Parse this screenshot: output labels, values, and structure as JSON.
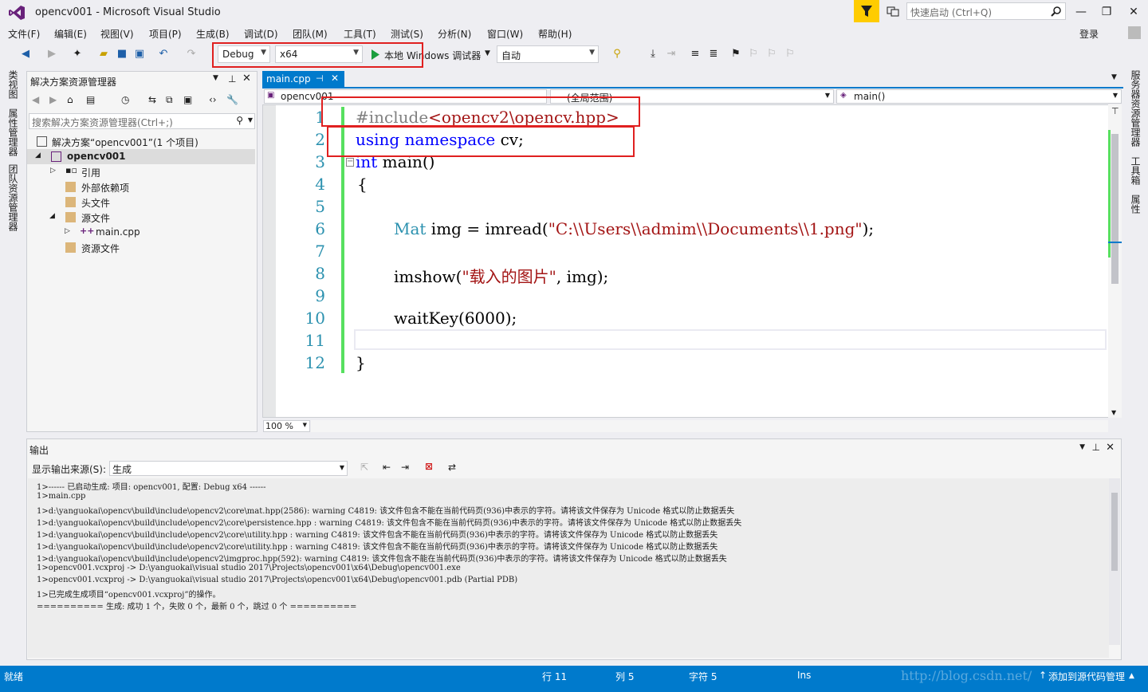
{
  "window": {
    "title": "opencv001 - Microsoft Visual Studio",
    "quick_launch_placeholder": "快速启动 (Ctrl+Q)",
    "login": "登录"
  },
  "menu": [
    "文件(F)",
    "编辑(E)",
    "视图(V)",
    "项目(P)",
    "生成(B)",
    "调试(D)",
    "团队(M)",
    "工具(T)",
    "测试(S)",
    "分析(N)",
    "窗口(W)",
    "帮助(H)"
  ],
  "toolbar": {
    "config": "Debug",
    "platform": "x64",
    "run_label": "本地 Windows 调试器",
    "run_mode": "自动"
  },
  "left_vtabs": [
    "类视图",
    "属性管理器",
    "团队资源管理器"
  ],
  "right_vtabs": [
    "服务器资源管理器",
    "工具箱",
    "属性"
  ],
  "solution_explorer": {
    "title": "解决方案资源管理器",
    "search_placeholder": "搜索解决方案资源管理器(Ctrl+;)",
    "items": [
      {
        "label": "解决方案“opencv001”(1 个项目)"
      },
      {
        "label": "opencv001"
      },
      {
        "label": "引用"
      },
      {
        "label": "外部依赖项"
      },
      {
        "label": "头文件"
      },
      {
        "label": "源文件"
      },
      {
        "label": "main.cpp"
      },
      {
        "label": "资源文件"
      }
    ]
  },
  "editor": {
    "tab_label": "main.cpp",
    "nav_project": "opencv001",
    "nav_scope": "(全局范围)",
    "nav_member": "main()",
    "zoom": "100 %",
    "line_numbers": [
      "1",
      "2",
      "3",
      "4",
      "5",
      "6",
      "7",
      "8",
      "9",
      "10",
      "11",
      "12"
    ],
    "code": {
      "l1_a": "#include",
      "l1_b": "<opencv2\\opencv.hpp>",
      "l2_a": "using",
      "l2_b": "namespace",
      "l2_c": " cv;",
      "l3_a": "int",
      "l3_b": " main()",
      "l4": "{",
      "l6_a": "Mat",
      "l6_b": " img = imread(",
      "l6_c": "\"C:\\\\Users\\\\admim\\\\Documents\\\\1.png\"",
      "l6_d": ");",
      "l8_a": "imshow(",
      "l8_b": "\"载入的图片\"",
      "l8_c": ", img);",
      "l10": "waitKey(6000);",
      "l12": "}"
    }
  },
  "output": {
    "title": "输出",
    "source_label": "显示输出来源(S):",
    "source_value": "生成",
    "lines": [
      "1>------ 已启动生成: 项目: opencv001, 配置: Debug x64 ------",
      "1>main.cpp",
      "1>d:\\yanguokai\\opencv\\build\\include\\opencv2\\core\\mat.hpp(2586): warning C4819: 该文件包含不能在当前代码页(936)中表示的字符。请将该文件保存为 Unicode 格式以防止数据丢失",
      "1>d:\\yanguokai\\opencv\\build\\include\\opencv2\\core\\persistence.hpp : warning C4819: 该文件包含不能在当前代码页(936)中表示的字符。请将该文件保存为 Unicode 格式以防止数据丢失",
      "1>d:\\yanguokai\\opencv\\build\\include\\opencv2\\core\\utility.hpp : warning C4819: 该文件包含不能在当前代码页(936)中表示的字符。请将该文件保存为 Unicode 格式以防止数据丢失",
      "1>d:\\yanguokai\\opencv\\build\\include\\opencv2\\core\\utility.hpp : warning C4819: 该文件包含不能在当前代码页(936)中表示的字符。请将该文件保存为 Unicode 格式以防止数据丢失",
      "1>d:\\yanguokai\\opencv\\build\\include\\opencv2\\imgproc.hpp(592): warning C4819: 该文件包含不能在当前代码页(936)中表示的字符。请将该文件保存为 Unicode 格式以防止数据丢失",
      "1>opencv001.vcxproj -> D:\\yanguokai\\visual studio 2017\\Projects\\opencv001\\x64\\Debug\\opencv001.exe",
      "1>opencv001.vcxproj -> D:\\yanguokai\\visual studio 2017\\Projects\\opencv001\\x64\\Debug\\opencv001.pdb (Partial PDB)",
      "1>已完成生成项目“opencv001.vcxproj”的操作。",
      "========== 生成: 成功 1 个，失败 0 个，最新 0 个，跳过 0 个 =========="
    ]
  },
  "status": {
    "ready": "就绪",
    "line": "行 11",
    "col": "列 5",
    "char": "字符 5",
    "ins": "Ins",
    "source_control": "添加到源代码管理",
    "watermark": "http://blog.csdn.net/"
  }
}
